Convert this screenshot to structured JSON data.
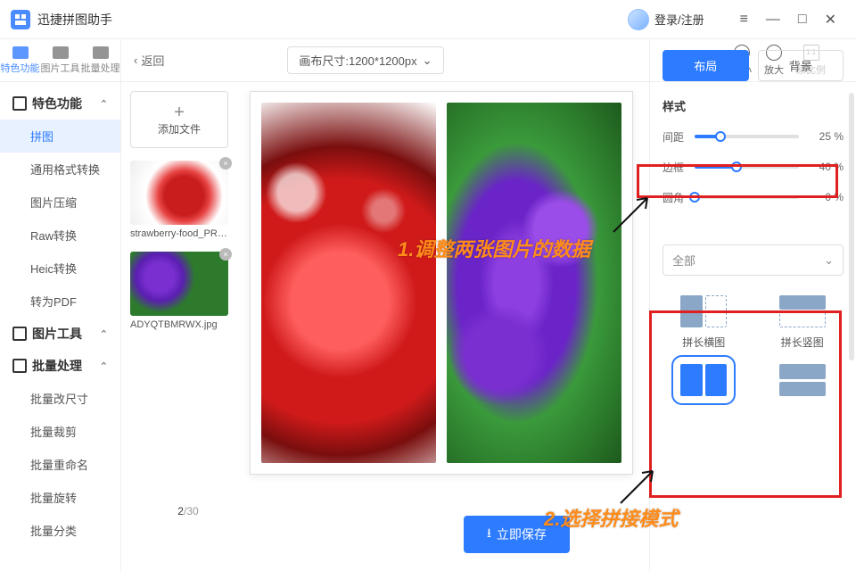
{
  "titlebar": {
    "app_name": "迅捷拼图助手",
    "login_label": "登录/注册"
  },
  "nav_tabs": {
    "t0": "特色功能",
    "t1": "图片工具",
    "t2": "批量处理"
  },
  "sidebar": {
    "group_features": "特色功能",
    "items_features": {
      "i0": "拼图",
      "i1": "通用格式转换",
      "i2": "图片压缩",
      "i3": "Raw转换",
      "i4": "Heic转换",
      "i5": "转为PDF"
    },
    "group_tools": "图片工具",
    "group_batch": "批量处理",
    "items_batch": {
      "b0": "批量改尺寸",
      "b1": "批量裁剪",
      "b2": "批量重命名",
      "b3": "批量旋转",
      "b4": "批量分类"
    }
  },
  "topbar": {
    "back": "返回",
    "canvas_size": "画布尺寸:1200*1200px",
    "zoom_out": "缩小",
    "zoom_in": "放大",
    "zoom_reset": "原比例",
    "zoom_ratio": "1:1"
  },
  "gallery": {
    "add_file": "添加文件",
    "thumb1_name": "strawberry-food_PRO...",
    "thumb2_name": "ADYQTBMRWX.jpg",
    "count_cur": "2",
    "count_sep": "/",
    "count_total": "30"
  },
  "export_label": "立即保存",
  "right": {
    "tab_layout": "布局",
    "tab_bg": "背景",
    "section_style": "样式",
    "slider_gap": "间距",
    "slider_gap_val": "25 %",
    "slider_border": "边框",
    "slider_border_val": "40 %",
    "slider_radius": "圆角",
    "slider_radius_val": "0 %",
    "dropdown_all": "全部",
    "layout_h": "拼长横图",
    "layout_v": "拼长竖图"
  },
  "annotations": {
    "a1": "1.调整两张图片的数据",
    "a2": "2.选择拼接模式"
  }
}
